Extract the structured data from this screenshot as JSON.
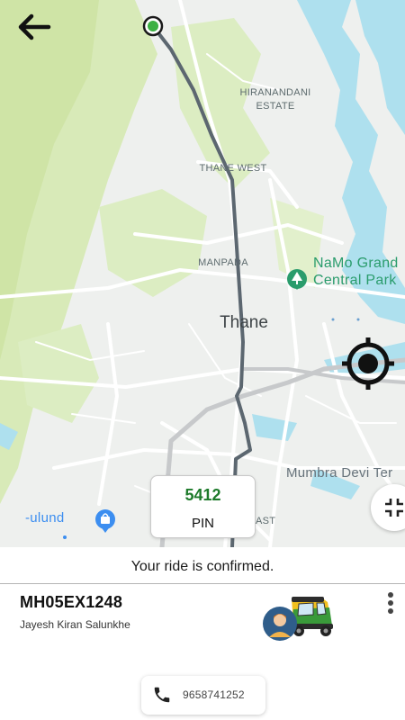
{
  "map": {
    "labels": {
      "hiranandani": "HIRANANDANI\nESTATE",
      "thane_west": "THANE WEST",
      "manpada": "MANPADA",
      "thane": "Thane",
      "namo": "NaMo Grand\nCentral Park",
      "mumbra": "Mumbra Devi Ter",
      "mulund": "-ulund",
      "east": "AST"
    },
    "colors": {
      "water": "#aee0ee",
      "green": "#d6e9b4",
      "route": "#5c6770",
      "start_marker": "#3cb043"
    }
  },
  "toolbar": {
    "back_icon": "arrow-left-icon",
    "locate_icon": "gps-target-icon",
    "collapse_icon": "fullscreen-exit-icon"
  },
  "pin": {
    "value": "5412",
    "label": "PIN"
  },
  "status": {
    "message": "Your ride is confirmed."
  },
  "driver": {
    "vehicle_number": "MH05EX1248",
    "name": "Jayesh Kiran Salunkhe",
    "phone": "9658741252"
  }
}
